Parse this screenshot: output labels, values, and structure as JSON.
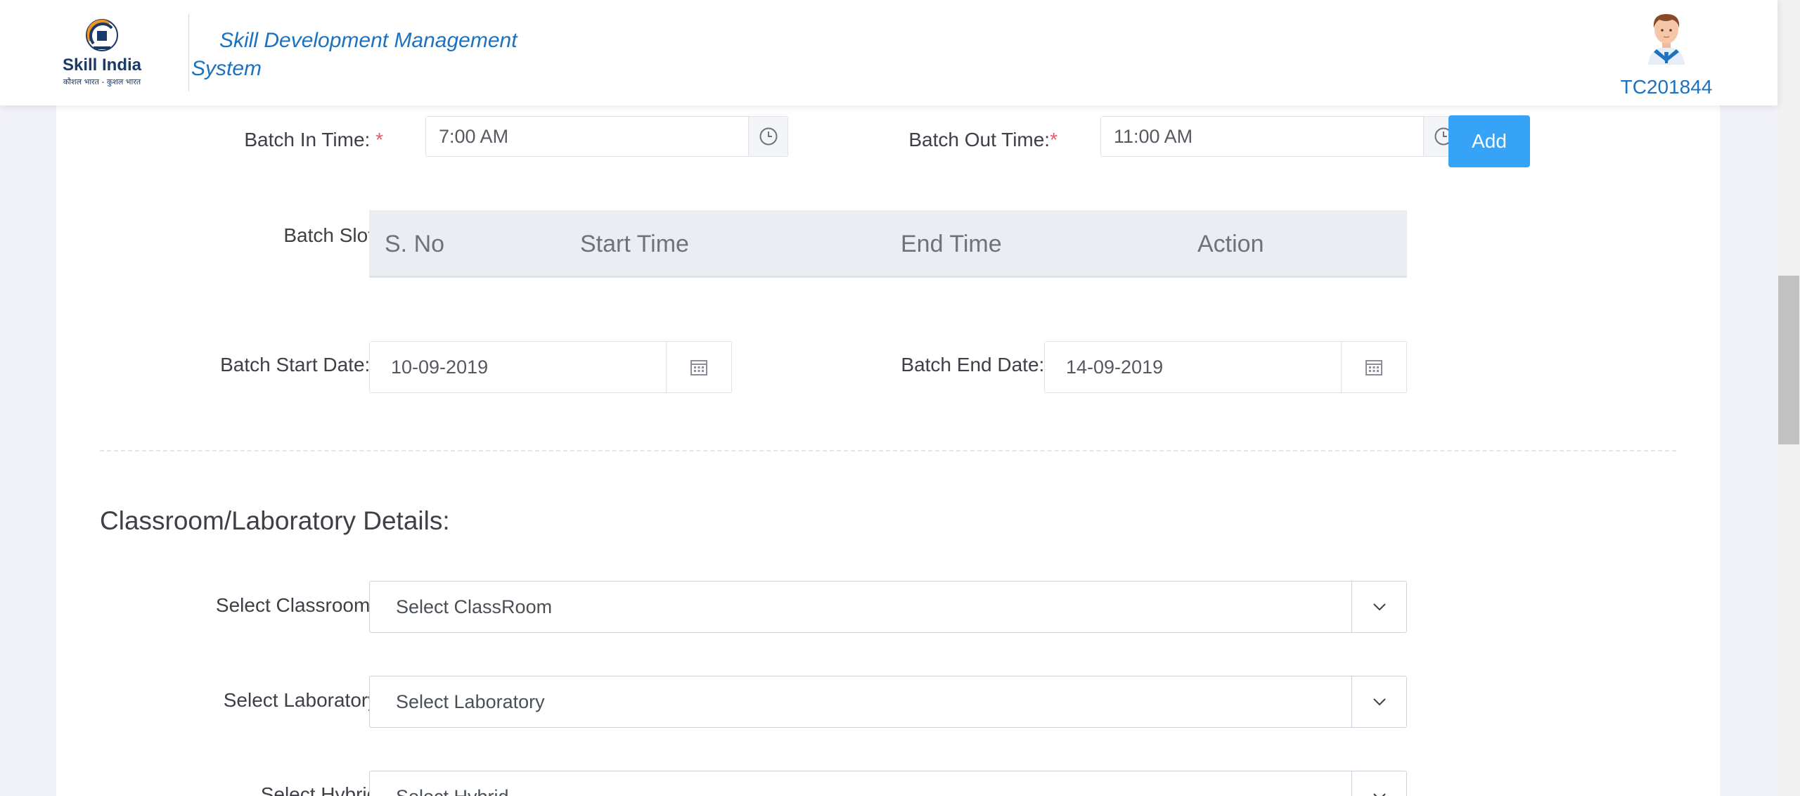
{
  "header": {
    "app_title_line1": "Skill Development Management",
    "app_title_line2": "System",
    "user_id": "TC201844",
    "logo_text": "Skill India",
    "logo_subtext": "कौशल भारत - कुशल भारत"
  },
  "batch_time": {
    "in_label": "Batch In Time:",
    "in_value": "7:00 AM",
    "out_label": "Batch Out Time:",
    "out_value": "11:00 AM",
    "add_label": "Add",
    "required_mark": "*"
  },
  "batch_slots": {
    "label": "Batch Slots",
    "columns": [
      "S. No",
      "Start Time",
      "End Time",
      "Action"
    ]
  },
  "batch_dates": {
    "start_label": "Batch Start Date:",
    "start_value": "10-09-2019",
    "end_label": "Batch End Date:",
    "end_value": "14-09-2019"
  },
  "classroom_section": {
    "title": "Classroom/Laboratory Details:",
    "classroom_label": "Select Classroom:",
    "classroom_value": "Select ClassRoom",
    "laboratory_label": "Select Laboratory:",
    "laboratory_value": "Select Laboratory",
    "hybrid_label": "Select Hybrid:",
    "hybrid_value": "Select Hybrid"
  },
  "colors": {
    "accent": "#36a3f7",
    "brand_blue": "#1b72c0",
    "required": "#f4516c"
  },
  "icons": [
    "clock-icon",
    "calendar-icon",
    "chevron-down-icon",
    "user-avatar-icon"
  ]
}
